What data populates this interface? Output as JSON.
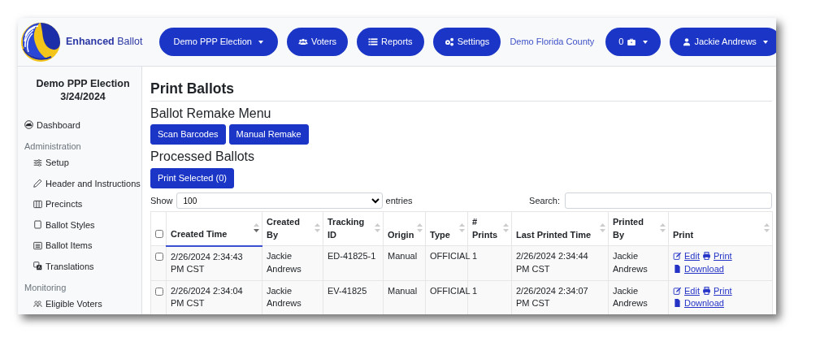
{
  "brand": "**Enhanced** Ballot",
  "nav_buttons": [
    {
      "label": "Demo PPP Election",
      "kind": "dropdown"
    },
    {
      "label": "Voters",
      "kind": "link"
    },
    {
      "label": "Reports",
      "kind": "link"
    },
    {
      "label": "Settings",
      "kind": "link"
    }
  ],
  "county": "Demo Florida County",
  "cart_button": {
    "label": "0"
  },
  "user_button": {
    "label": "Jackie Andrews"
  },
  "sidebar": {
    "title": "Demo PPP Election",
    "date": "3/24/2024",
    "sections": [
      {
        "items": [
          {
            "label": "Dashboard"
          }
        ]
      },
      {
        "heading": "Administration",
        "items": [
          {
            "label": "Setup"
          },
          {
            "label": "Header and Instructions"
          },
          {
            "label": "Precincts"
          },
          {
            "label": "Ballot Styles"
          },
          {
            "label": "Ballot Items"
          },
          {
            "label": "Translations"
          }
        ]
      },
      {
        "heading": "Monitoring",
        "items": [
          {
            "label": "Eligible Voters"
          }
        ]
      }
    ]
  },
  "page_title": "Print Ballots",
  "remake": {
    "heading": "Ballot Remake Menu",
    "buttons": [
      "Scan Barcodes",
      "Manual Remake"
    ]
  },
  "processed": {
    "heading": "Processed Ballots",
    "print_button": "Print Selected (0)",
    "length": {
      "before": "Show",
      "value": "100",
      "after": "entries"
    },
    "search": {
      "label": "Search:"
    },
    "select_all": {
      "checked": false
    },
    "columns": [
      {
        "label": "Created Time",
        "sorted": true
      },
      {
        "label": "Created By",
        "sorted": false
      },
      {
        "label": "Tracking ID",
        "sorted": false
      },
      {
        "label": "Origin",
        "sorted": false
      },
      {
        "label": "Type",
        "sorted": false
      },
      {
        "label": "# Prints",
        "sorted": false
      },
      {
        "label": "Last Printed Time",
        "sorted": false
      },
      {
        "label": "Printed By",
        "sorted": false
      },
      {
        "label": "Print",
        "sorted": false
      }
    ],
    "rows": [
      {
        "checked": false,
        "cells": [
          "2/26/2024 2:34:43 PM CST",
          "Jackie Andrews",
          "ED-41825-1",
          "Manual",
          "OFFICIAL",
          "1",
          "2/26/2024 2:34:44 PM CST",
          "Jackie Andrews"
        ],
        "actions": [
          "Edit",
          "Print",
          "Download"
        ]
      },
      {
        "checked": false,
        "cells": [
          "2/26/2024 2:34:04 PM CST",
          "Jackie Andrews",
          "EV-41825",
          "Manual",
          "OFFICIAL",
          "1",
          "2/26/2024 2:34:07 PM CST",
          "Jackie Andrews"
        ],
        "actions": [
          "Edit",
          "Print",
          "Download"
        ]
      }
    ]
  }
}
